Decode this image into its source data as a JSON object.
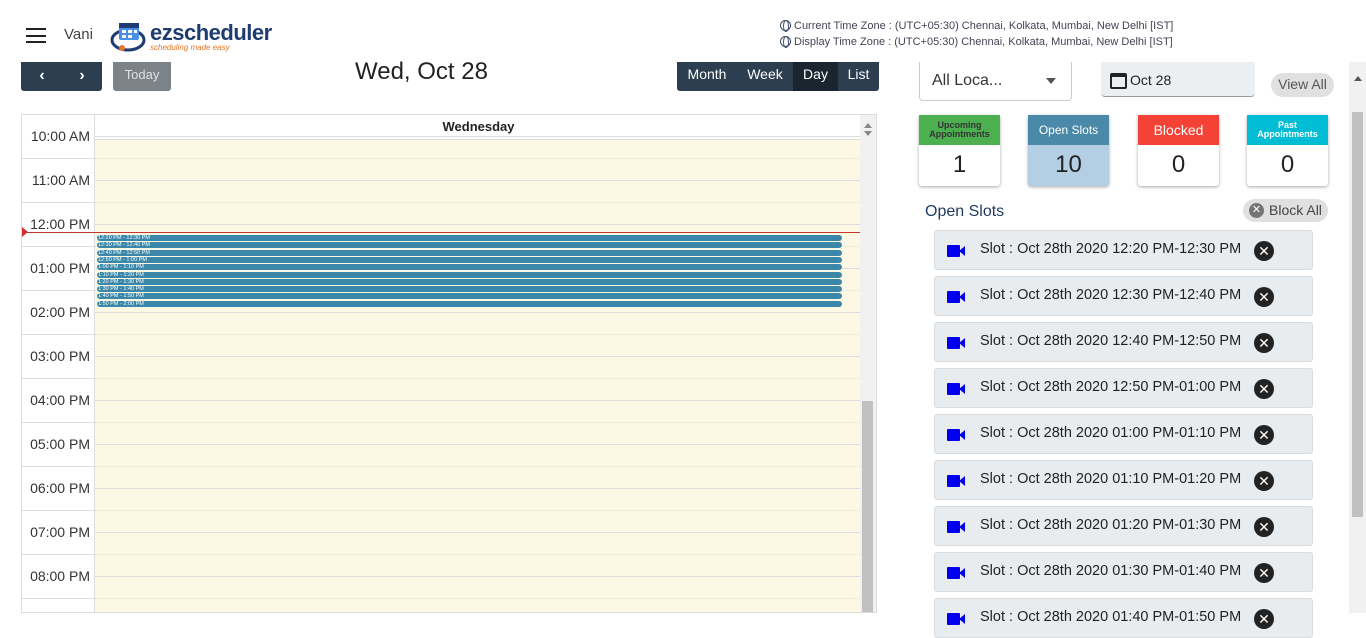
{
  "header": {
    "user_name": "Vani",
    "logo_text": "ezscheduler",
    "logo_tagline": "scheduling made easy",
    "current_tz": "Current Time Zone : (UTC+05:30) Chennai, Kolkata, Mumbai, New Delhi [IST]",
    "display_tz": "Display Time Zone : (UTC+05:30) Chennai, Kolkata, Mumbai, New Delhi [IST]"
  },
  "calendar": {
    "prev_label": "‹",
    "next_label": "›",
    "today_label": "Today",
    "title": "Wed, Oct 28",
    "views": [
      "Month",
      "Week",
      "Day",
      "List"
    ],
    "active_view": "Day",
    "day_header": "Wednesday",
    "time_labels": [
      "10:00 AM",
      "11:00 AM",
      "12:00 PM",
      "01:00 PM",
      "02:00 PM",
      "03:00 PM",
      "04:00 PM",
      "05:00 PM",
      "06:00 PM",
      "07:00 PM",
      "08:00 PM"
    ],
    "events": [
      "12:20 PM - 12:30 PM",
      "12:30 PM - 12:40 PM",
      "12:40 PM - 12:50 PM",
      "12:50 PM - 1:00 PM",
      "1:00 PM - 1:10 PM",
      "1:10 PM - 1:20 PM",
      "1:20 PM - 1:30 PM",
      "1:30 PM - 1:40 PM",
      "1:40 PM - 1:50 PM",
      "1:50 PM - 2:00 PM"
    ]
  },
  "panel": {
    "location_value": "All Loca...",
    "date_value": "Oct 28",
    "view_all_label": "View All",
    "stats": {
      "upcoming": {
        "label": "Upcoming Appointments",
        "count": "1",
        "color": "#4caf50"
      },
      "open": {
        "label": "Open Slots",
        "count": "10",
        "color": "#4a8aa8"
      },
      "blocked": {
        "label": "Blocked",
        "count": "0",
        "color": "#f44336"
      },
      "past": {
        "label": "Past Appointments",
        "count": "0",
        "color": "#00bcd4"
      }
    },
    "open_slots_title": "Open Slots",
    "block_all_label": "Block All",
    "slots": [
      "Slot : Oct 28th 2020 12:20 PM-12:30 PM",
      "Slot : Oct 28th 2020 12:30 PM-12:40 PM",
      "Slot : Oct 28th 2020 12:40 PM-12:50 PM",
      "Slot : Oct 28th 2020 12:50 PM-01:00 PM",
      "Slot : Oct 28th 2020 01:00 PM-01:10 PM",
      "Slot : Oct 28th 2020 01:10 PM-01:20 PM",
      "Slot : Oct 28th 2020 01:20 PM-01:30 PM",
      "Slot : Oct 28th 2020 01:30 PM-01:40 PM",
      "Slot : Oct 28th 2020 01:40 PM-01:50 PM"
    ]
  }
}
